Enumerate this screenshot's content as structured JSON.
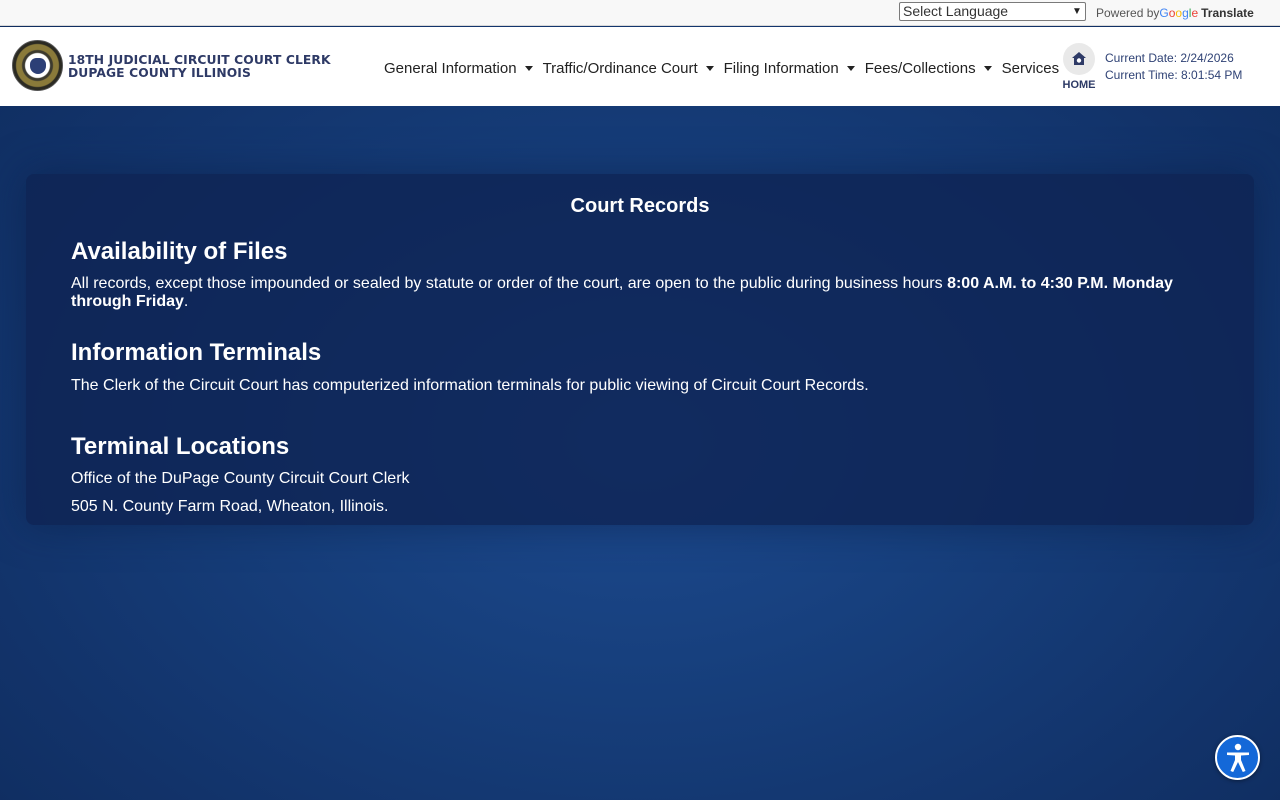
{
  "translate_bar": {
    "language_select": "Select Language",
    "powered_by": "Powered by",
    "google": [
      "G",
      "o",
      "o",
      "g",
      "l",
      "e"
    ],
    "translate": "Translate"
  },
  "header": {
    "brand_line1": "18TH JUDICIAL CIRCUIT COURT CLERK",
    "brand_line2": "DUPAGE COUNTY ILLINOIS",
    "nav": [
      {
        "label": "General Information"
      },
      {
        "label": "Traffic/Ordinance Court"
      },
      {
        "label": "Filing Information"
      },
      {
        "label": "Fees/Collections"
      },
      {
        "label": "Services"
      }
    ],
    "home_label": "HOME",
    "current_date": "Current Date: 2/24/2026",
    "current_time": "Current Time: 8:01:54 PM"
  },
  "main": {
    "title": "Court Records",
    "availability_heading": "Availability of Files",
    "availability_text": "All records, except those impounded or sealed by statute or order of the court, are open to the public during business hours ",
    "availability_hours": "8:00 A.M. to 4:30 P.M. Monday through Friday",
    "availability_end": ".",
    "terminals_heading": "Information Terminals",
    "terminals_text": "The Clerk of the Circuit Court has computerized information terminals for public viewing of Circuit Court Records.",
    "locations_heading": "Terminal Locations",
    "location_line1": "Office of the DuPage County Circuit Court Clerk",
    "location_line2": "505 N. County Farm Road, Wheaton, Illinois."
  },
  "icons": {
    "home": "home-icon",
    "accessibility": "accessibility-icon",
    "seal": "county-seal-logo"
  },
  "colors": {
    "brand_text": "#2e3a66",
    "background": "#17407e",
    "card": "#0e2352",
    "accessibility_button": "#1468d8"
  }
}
